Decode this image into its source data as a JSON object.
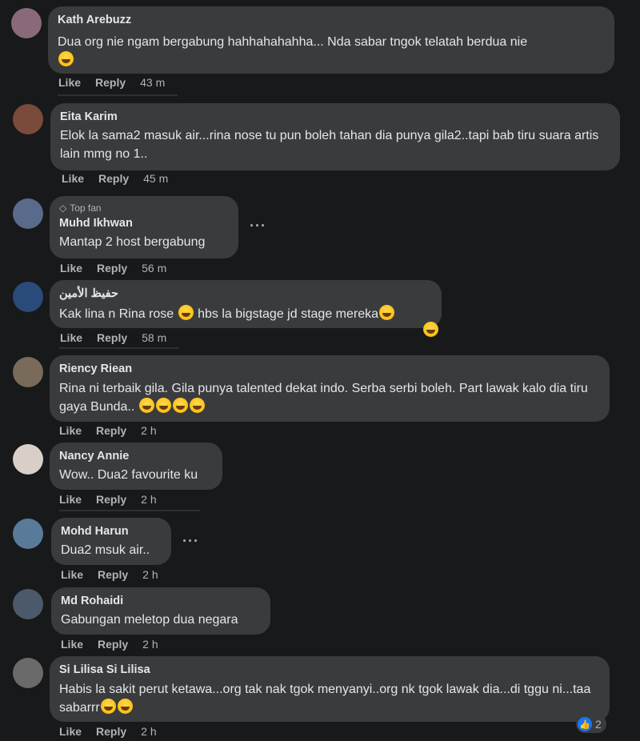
{
  "comments": [
    {
      "name": "Kath Arebuzz",
      "text": "Dua org nie ngam bergabung hahhahahahha... Nda sabar tngok telatah berdua nie",
      "like": "Like",
      "reply": "Reply",
      "time": "43 m",
      "avatar_color": "#8a6a7a"
    },
    {
      "name": "Eita Karim",
      "text": "Elok la sama2 masuk air...rina nose tu pun boleh tahan dia punya gila2..tapi bab tiru suara artis lain mmg no 1..",
      "like": "Like",
      "reply": "Reply",
      "time": "45 m",
      "avatar_color": "#7a4a3a"
    },
    {
      "badge": "Top fan",
      "name": "Muhd Ikhwan",
      "text": "Mantap 2 host bergabung",
      "like": "Like",
      "reply": "Reply",
      "time": "56 m",
      "more": "···",
      "avatar_color": "#5a6a8a"
    },
    {
      "name": "حفيظ الأمين",
      "text": "Kak lina n Rina rose",
      "text2": "hbs la bigstage jd stage mereka",
      "like": "Like",
      "reply": "Reply",
      "time": "58 m",
      "avatar_color": "#2a4a7a"
    },
    {
      "name": "Riency Riean",
      "text": "Rina ni terbaik gila. Gila punya talented dekat indo. Serba serbi boleh. Part lawak kalo dia tiru gaya Bunda..",
      "like": "Like",
      "reply": "Reply",
      "time": "2 h",
      "avatar_color": "#7a6a5a"
    },
    {
      "name": "Nancy Annie",
      "text": "Wow.. Dua2 favourite ku",
      "like": "Like",
      "reply": "Reply",
      "time": "2 h",
      "avatar_color": "#d8d0c8"
    },
    {
      "name": "Mohd Harun",
      "text": "Dua2 msuk air..",
      "like": "Like",
      "reply": "Reply",
      "time": "2 h",
      "more": "···",
      "avatar_color": "#5a7a9a"
    },
    {
      "name": "Md Rohaidi",
      "text": "Gabungan meletop dua negara",
      "like": "Like",
      "reply": "Reply",
      "time": "2 h",
      "avatar_color": "#4a5a6a"
    },
    {
      "name": "Si Lilisa Si Lilisa",
      "text": "Habis la sakit perut ketawa...org tak nak tgok menyanyi..org nk tgok lawak dia...di tggu ni...taa sabarrr",
      "like": "Like",
      "reply": "Reply",
      "time": "2 h",
      "reaction_count": "2",
      "avatar_color": "#6a6a6a"
    }
  ],
  "icons": {
    "diamond": "top-fan-diamond-icon",
    "like": "like-reaction-icon",
    "more": "more-options-icon"
  },
  "colors": {
    "background": "#18191a",
    "bubble": "#3a3b3c",
    "text": "#e4e6eb",
    "muted": "#b0b3b8",
    "like_blue": "#1877f2"
  }
}
